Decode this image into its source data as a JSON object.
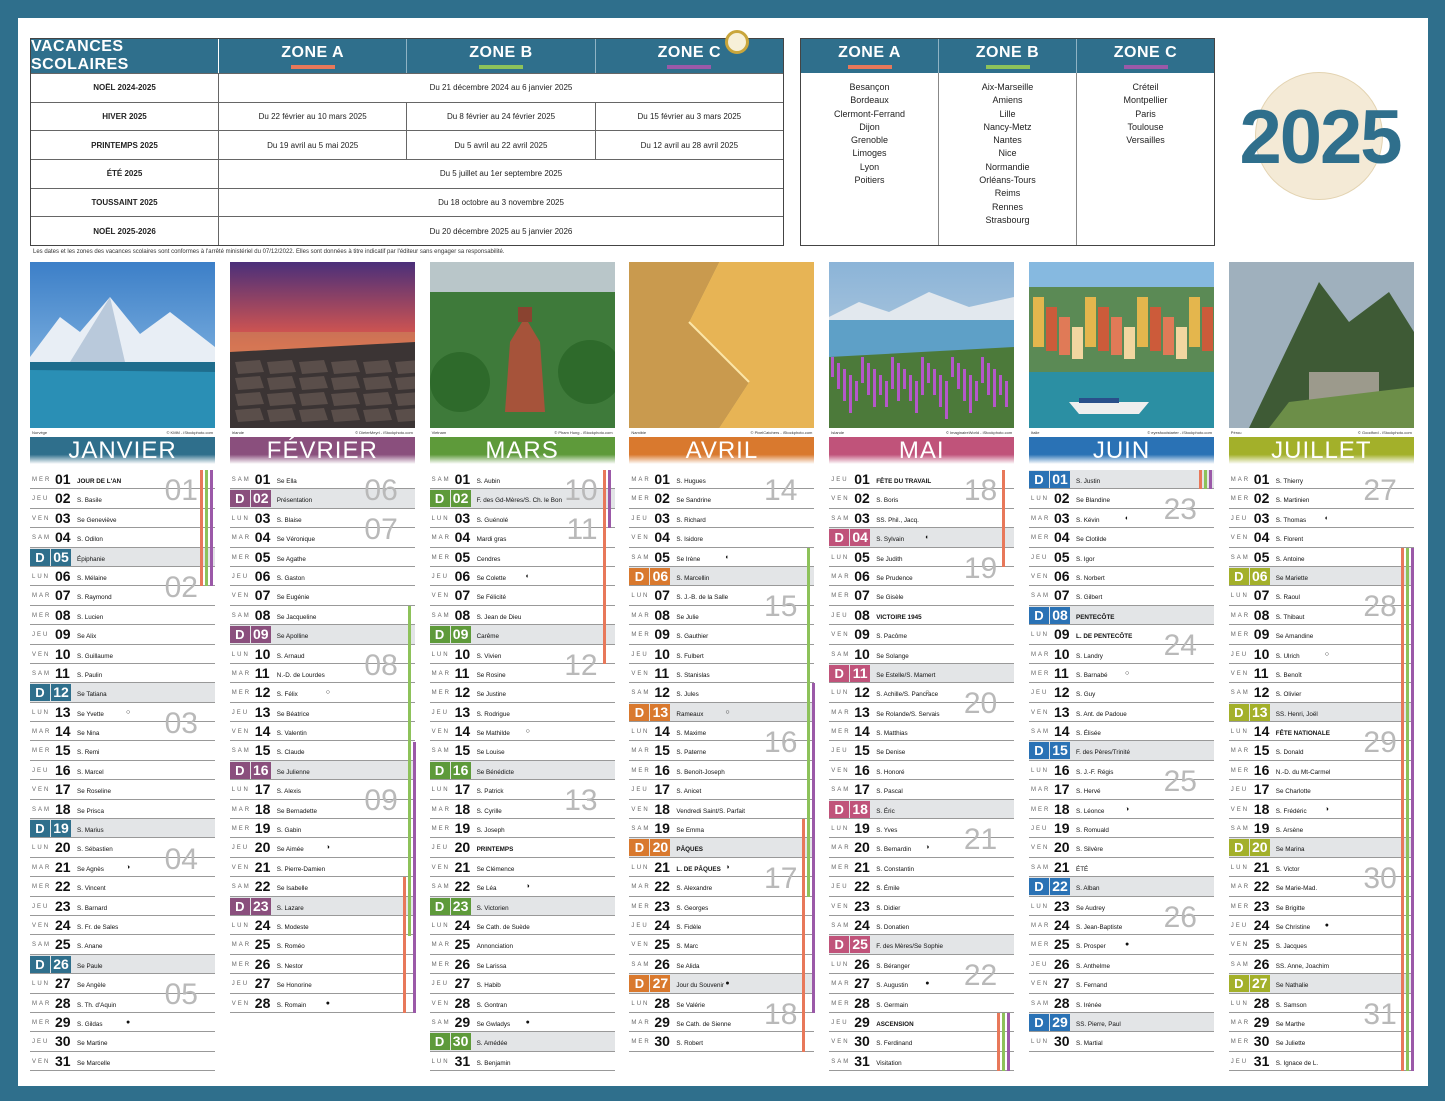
{
  "year": "2025",
  "colors": {
    "brand": "#2f6f8c",
    "zone_a": "#e8785a",
    "zone_b": "#8dc25a",
    "zone_c": "#9b59a8"
  },
  "holidays": {
    "title": "VACANCES SCOLAIRES",
    "zones": [
      "ZONE A",
      "ZONE B",
      "ZONE C"
    ],
    "rows": [
      {
        "label": "NOËL 2024-2025",
        "cells": [
          "Du 21 décembre 2024 au 6 janvier 2025"
        ]
      },
      {
        "label": "HIVER 2025",
        "cells": [
          "Du 22 février au 10 mars 2025",
          "Du 8 février au 24 février 2025",
          "Du 15 février au 3 mars 2025"
        ]
      },
      {
        "label": "PRINTEMPS 2025",
        "cells": [
          "Du 19 avril au 5 mai 2025",
          "Du 5 avril au 22 avril 2025",
          "Du 12 avril au 28 avril 2025"
        ]
      },
      {
        "label": "ÉTÉ 2025",
        "cells": [
          "Du 5 juillet au 1er septembre 2025"
        ]
      },
      {
        "label": "TOUSSAINT 2025",
        "cells": [
          "Du 18 octobre au 3 novembre 2025"
        ]
      },
      {
        "label": "NOËL 2025-2026",
        "cells": [
          "Du 20 décembre 2025 au 5 janvier 2026"
        ]
      }
    ],
    "note": "Les dates et les zones des vacances scolaires sont conformes à l'arrêté ministériel du 07/12/2022. Elles sont données à titre indicatif par l'éditeur sans engager sa responsabilité."
  },
  "zone_cities": [
    {
      "zone": "ZONE A",
      "cities": [
        "Besançon",
        "Bordeaux",
        "Clermont-Ferrand",
        "Dijon",
        "Grenoble",
        "Limoges",
        "Lyon",
        "Poitiers"
      ]
    },
    {
      "zone": "ZONE B",
      "cities": [
        "Aix-Marseille",
        "Amiens",
        "Lille",
        "Nancy-Metz",
        "Nantes",
        "Nice",
        "Normandie",
        "Orléans-Tours",
        "Reims",
        "Rennes",
        "Strasbourg"
      ]
    },
    {
      "zone": "ZONE C",
      "cities": [
        "Créteil",
        "Montpellier",
        "Paris",
        "Toulouse",
        "Versailles"
      ]
    }
  ],
  "dow_labels": {
    "L": "LUN",
    "M": "MAR",
    "E": "MER",
    "J": "JEU",
    "V": "VEN",
    "S": "SAM",
    "D": "D"
  },
  "months": [
    {
      "name": "JANVIER",
      "color": "#2f6f8c",
      "caption": "Norvège",
      "credit": "© KMM - iStockphoto.com",
      "first_dow": 3,
      "weeks": [
        "01",
        "02",
        "03",
        "04",
        "05"
      ],
      "days": [
        {
          "saint": "JOUR DE L'AN",
          "bold": true
        },
        {
          "saint": "S. Basile"
        },
        {
          "saint": "Se Geneviève"
        },
        {
          "saint": "S. Odilon"
        },
        {
          "saint": "Épiphanie"
        },
        {
          "saint": "S. Mélaine"
        },
        {
          "saint": "S. Raymond"
        },
        {
          "saint": "S. Lucien"
        },
        {
          "saint": "Se Alix"
        },
        {
          "saint": "S. Guillaume"
        },
        {
          "saint": "S. Paulin"
        },
        {
          "saint": "Se Tatiana"
        },
        {
          "saint": "Se Yvette",
          "moon": "○"
        },
        {
          "saint": "Se Nina"
        },
        {
          "saint": "S. Remi"
        },
        {
          "saint": "S. Marcel"
        },
        {
          "saint": "Se Roseline"
        },
        {
          "saint": "Se Prisca"
        },
        {
          "saint": "S. Marius"
        },
        {
          "saint": "S. Sébastien"
        },
        {
          "saint": "Se Agnès",
          "moon": "◑"
        },
        {
          "saint": "S. Vincent"
        },
        {
          "saint": "S. Barnard"
        },
        {
          "saint": "S. Fr. de Sales"
        },
        {
          "saint": "S. Anane"
        },
        {
          "saint": "Se Paule"
        },
        {
          "saint": "Se Angèle"
        },
        {
          "saint": "S. Th. d'Aquin"
        },
        {
          "saint": "S. Gildas",
          "moon": "●"
        },
        {
          "saint": "Se Martine"
        },
        {
          "saint": "Se Marcelle"
        }
      ]
    },
    {
      "name": "FÉVRIER",
      "color": "#8a4f7d",
      "caption": "Irlande",
      "credit": "© DieterMeyrl - iStockphoto.com",
      "first_dow": 6,
      "weeks": [
        "06",
        "07",
        "08",
        "09"
      ],
      "days": [
        {
          "saint": "Se Ella"
        },
        {
          "saint": "Présentation"
        },
        {
          "saint": "S. Blaise"
        },
        {
          "saint": "Se Véronique"
        },
        {
          "saint": "Se Agathe"
        },
        {
          "saint": "S. Gaston"
        },
        {
          "saint": "Se Eugénie"
        },
        {
          "saint": "Se Jacqueline"
        },
        {
          "saint": "Se Apolline"
        },
        {
          "saint": "S. Arnaud"
        },
        {
          "saint": "N.-D. de Lourdes"
        },
        {
          "saint": "S. Félix",
          "moon": "○"
        },
        {
          "saint": "Se Béatrice"
        },
        {
          "saint": "S. Valentin"
        },
        {
          "saint": "S. Claude"
        },
        {
          "saint": "Se Julienne"
        },
        {
          "saint": "S. Alexis"
        },
        {
          "saint": "Se Bernadette"
        },
        {
          "saint": "S. Gabin"
        },
        {
          "saint": "Se Aimée",
          "moon": "◑"
        },
        {
          "saint": "S. Pierre-Damien"
        },
        {
          "saint": "Se Isabelle"
        },
        {
          "saint": "S. Lazare"
        },
        {
          "saint": "S. Modeste"
        },
        {
          "saint": "S. Roméo"
        },
        {
          "saint": "S. Nestor"
        },
        {
          "saint": "Se Honorine"
        },
        {
          "saint": "S. Romain",
          "moon": "●"
        }
      ]
    },
    {
      "name": "MARS",
      "color": "#5e9a3a",
      "caption": "Vietnam",
      "credit": "© Pham Hung - iStockphoto.com",
      "first_dow": 6,
      "weeks": [
        "10",
        "11",
        "12",
        "13"
      ],
      "days": [
        {
          "saint": "S. Aubin"
        },
        {
          "saint": "F. des Gd-Mères/S. Ch. le Bon"
        },
        {
          "saint": "S. Guénolé"
        },
        {
          "saint": "Mardi gras"
        },
        {
          "saint": "Cendres"
        },
        {
          "saint": "Se Colette",
          "moon": "◐"
        },
        {
          "saint": "Se Félicité"
        },
        {
          "saint": "S. Jean de Dieu"
        },
        {
          "saint": "Carême"
        },
        {
          "saint": "S. Vivien"
        },
        {
          "saint": "Se Rosine"
        },
        {
          "saint": "Se Justine"
        },
        {
          "saint": "S. Rodrigue"
        },
        {
          "saint": "Se Mathilde",
          "moon": "○"
        },
        {
          "saint": "Se Louise"
        },
        {
          "saint": "Se Bénédicte"
        },
        {
          "saint": "S. Patrick"
        },
        {
          "saint": "S. Cyrille"
        },
        {
          "saint": "S. Joseph"
        },
        {
          "saint": "PRINTEMPS",
          "bold": true
        },
        {
          "saint": "Se Clémence"
        },
        {
          "saint": "Se Léa",
          "moon": "◑"
        },
        {
          "saint": "S. Victorien"
        },
        {
          "saint": "Se Cath. de Suède"
        },
        {
          "saint": "Annonciation"
        },
        {
          "saint": "Se Larissa"
        },
        {
          "saint": "S. Habib"
        },
        {
          "saint": "S. Gontran"
        },
        {
          "saint": "Se Gwladys",
          "moon": "●"
        },
        {
          "saint": "S. Amédée"
        },
        {
          "saint": "S. Benjamin"
        }
      ]
    },
    {
      "name": "AVRIL",
      "color": "#d9792e",
      "caption": "Namibie",
      "credit": "© PixelCatchers - iStockphoto.com",
      "first_dow": 2,
      "weeks": [
        "14",
        "15",
        "16",
        "17",
        "18"
      ],
      "days": [
        {
          "saint": "S. Hugues"
        },
        {
          "saint": "Se Sandrine"
        },
        {
          "saint": "S. Richard"
        },
        {
          "saint": "S. Isidore"
        },
        {
          "saint": "Se Irène",
          "moon": "◐"
        },
        {
          "saint": "S. Marcellin"
        },
        {
          "saint": "S. J.-B. de la Salle"
        },
        {
          "saint": "Se Julie"
        },
        {
          "saint": "S. Gauthier"
        },
        {
          "saint": "S. Fulbert"
        },
        {
          "saint": "S. Stanislas"
        },
        {
          "saint": "S. Jules"
        },
        {
          "saint": "Rameaux",
          "moon": "○"
        },
        {
          "saint": "S. Maxime"
        },
        {
          "saint": "S. Paterne"
        },
        {
          "saint": "S. Benoît-Joseph"
        },
        {
          "saint": "S. Anicet"
        },
        {
          "saint": "Vendredi Saint/S. Parfait"
        },
        {
          "saint": "Se Emma"
        },
        {
          "saint": "PÂQUES",
          "bold": true
        },
        {
          "saint": "L. DE PÂQUES",
          "bold": true,
          "moon": "◑"
        },
        {
          "saint": "S. Alexandre"
        },
        {
          "saint": "S. Georges"
        },
        {
          "saint": "S. Fidèle"
        },
        {
          "saint": "S. Marc"
        },
        {
          "saint": "Se Alida"
        },
        {
          "saint": "Jour du Souvenir",
          "moon": "●"
        },
        {
          "saint": "Se Valérie"
        },
        {
          "saint": "Se Cath. de Sienne"
        },
        {
          "saint": "S. Robert"
        }
      ]
    },
    {
      "name": "MAI",
      "color": "#c0537a",
      "caption": "Islande",
      "credit": "© ImaginaireWorld - iStockphoto.com",
      "first_dow": 4,
      "weeks": [
        "18",
        "19",
        "20",
        "21",
        "22"
      ],
      "days": [
        {
          "saint": "FÊTE DU TRAVAIL",
          "bold": true
        },
        {
          "saint": "S. Boris"
        },
        {
          "saint": "SS. Phil., Jacq."
        },
        {
          "saint": "S. Sylvain",
          "moon": "◐"
        },
        {
          "saint": "Se Judith"
        },
        {
          "saint": "Se Prudence"
        },
        {
          "saint": "Se Gisèle"
        },
        {
          "saint": "VICTOIRE 1945",
          "bold": true
        },
        {
          "saint": "S. Pacôme"
        },
        {
          "saint": "Se Solange"
        },
        {
          "saint": "Se Estelle/S. Mamert"
        },
        {
          "saint": "S. Achille/S. Pancrace",
          "moon": "○"
        },
        {
          "saint": "Se Rolande/S. Servais"
        },
        {
          "saint": "S. Matthias"
        },
        {
          "saint": "Se Denise"
        },
        {
          "saint": "S. Honoré"
        },
        {
          "saint": "S. Pascal"
        },
        {
          "saint": "S. Éric"
        },
        {
          "saint": "S. Yves"
        },
        {
          "saint": "S. Bernardin",
          "moon": "◑"
        },
        {
          "saint": "S. Constantin"
        },
        {
          "saint": "S. Émile"
        },
        {
          "saint": "S. Didier"
        },
        {
          "saint": "S. Donatien"
        },
        {
          "saint": "F. des Mères/Se Sophie"
        },
        {
          "saint": "S. Béranger"
        },
        {
          "saint": "S. Augustin",
          "moon": "●"
        },
        {
          "saint": "S. Germain"
        },
        {
          "saint": "ASCENSION",
          "bold": true
        },
        {
          "saint": "S. Ferdinand"
        },
        {
          "saint": "Visitation"
        }
      ]
    },
    {
      "name": "JUIN",
      "color": "#2a72b5",
      "caption": "Italie",
      "credit": "© eyesfoodstarter - iStockphoto.com",
      "first_dow": 0,
      "weeks": [
        "23",
        "24",
        "25",
        "26"
      ],
      "days": [
        {
          "saint": "S. Justin"
        },
        {
          "saint": "Se Blandine"
        },
        {
          "saint": "S. Kévin",
          "moon": "◐"
        },
        {
          "saint": "Se Clotilde"
        },
        {
          "saint": "S. Igor"
        },
        {
          "saint": "S. Norbert"
        },
        {
          "saint": "S. Gilbert"
        },
        {
          "saint": "PENTECÔTE",
          "bold": true
        },
        {
          "saint": "L. DE PENTECÔTE",
          "bold": true
        },
        {
          "saint": "S. Landry"
        },
        {
          "saint": "S. Barnabé",
          "moon": "○"
        },
        {
          "saint": "S. Guy"
        },
        {
          "saint": "S. Ant. de Padoue"
        },
        {
          "saint": "S. Élisée"
        },
        {
          "saint": "F. des Pères/Trinité"
        },
        {
          "saint": "S. J.-F. Régis"
        },
        {
          "saint": "S. Hervé"
        },
        {
          "saint": "S. Léonce",
          "moon": "◑"
        },
        {
          "saint": "S. Romuald"
        },
        {
          "saint": "S. Silvère"
        },
        {
          "saint": "ÉTÉ"
        },
        {
          "saint": "S. Alban"
        },
        {
          "saint": "Se Audrey"
        },
        {
          "saint": "S. Jean-Baptiste"
        },
        {
          "saint": "S. Prosper",
          "moon": "●"
        },
        {
          "saint": "S. Anthelme"
        },
        {
          "saint": "S. Fernand"
        },
        {
          "saint": "S. Irénée"
        },
        {
          "saint": "SS. Pierre, Paul"
        },
        {
          "saint": "S. Martial"
        }
      ]
    },
    {
      "name": "JUILLET",
      "color": "#a3b02a",
      "caption": "Pérou",
      "credit": "© Goodford - iStockphoto.com",
      "first_dow": 2,
      "weeks": [
        "27",
        "28",
        "29",
        "30",
        "31"
      ],
      "days": [
        {
          "saint": "S. Thierry"
        },
        {
          "saint": "S. Martinien"
        },
        {
          "saint": "S. Thomas",
          "moon": "◐"
        },
        {
          "saint": "S. Florent"
        },
        {
          "saint": "S. Antoine"
        },
        {
          "saint": "Se Mariette"
        },
        {
          "saint": "S. Raoul"
        },
        {
          "saint": "S. Thibaut"
        },
        {
          "saint": "Se Amandine"
        },
        {
          "saint": "S. Ulrich",
          "moon": "○"
        },
        {
          "saint": "S. Benoît"
        },
        {
          "saint": "S. Olivier"
        },
        {
          "saint": "SS. Henri, Joël"
        },
        {
          "saint": "FÊTE NATIONALE",
          "bold": true
        },
        {
          "saint": "S. Donald"
        },
        {
          "saint": "N.-D. du Mt-Carmel"
        },
        {
          "saint": "Se Charlotte"
        },
        {
          "saint": "S. Frédéric",
          "moon": "◑"
        },
        {
          "saint": "S. Arsène"
        },
        {
          "saint": "Se Marina"
        },
        {
          "saint": "S. Victor"
        },
        {
          "saint": "Se Marie-Mad."
        },
        {
          "saint": "Se Brigitte"
        },
        {
          "saint": "Se Christine",
          "moon": "●"
        },
        {
          "saint": "S. Jacques"
        },
        {
          "saint": "SS. Anne, Joachim"
        },
        {
          "saint": "Se Nathalie"
        },
        {
          "saint": "S. Samson"
        },
        {
          "saint": "Se Marthe"
        },
        {
          "saint": "Se Juliette"
        },
        {
          "saint": "S. Ignace de L."
        }
      ]
    }
  ]
}
